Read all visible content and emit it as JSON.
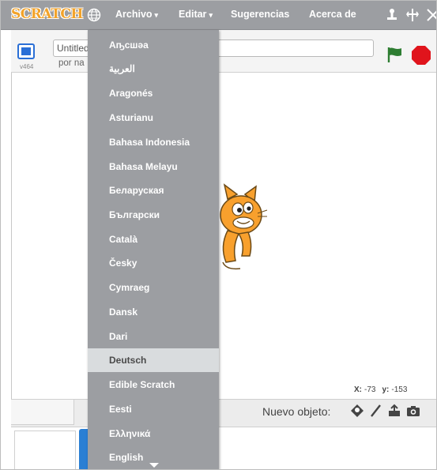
{
  "menubar": {
    "logo_text": "SCRATCH",
    "globe_icon": "globe-icon",
    "menus": [
      {
        "label": "Archivo",
        "has_arrow": true
      },
      {
        "label": "Editar",
        "has_arrow": true
      },
      {
        "label": "Sugerencias"
      },
      {
        "label": "Acerca de"
      }
    ],
    "arrow_glyph": "▾",
    "tool_icons": [
      "duplicate-stamp-icon",
      "cut-scissors-icon",
      "grow-icon"
    ]
  },
  "stage": {
    "version": "v464",
    "title_value": "Untitled",
    "byline": "por na"
  },
  "coords": {
    "x_label": "X:",
    "x_value": "-73",
    "y_label": "y:",
    "y_value": "-153"
  },
  "sprites": {
    "new_sprite_label": "Nuevo objeto:",
    "new_sprite_icons": [
      "sprite-library-icon",
      "paint-brush-icon",
      "upload-sprite-icon",
      "camera-icon"
    ]
  },
  "language_menu": {
    "items": [
      "Аҧсшәа",
      "العربية",
      "Aragonés",
      "Asturianu",
      "Bahasa Indonesia",
      "Bahasa Melayu",
      "Беларуская",
      "Български",
      "Català",
      "Česky",
      "Cymraeg",
      "Dansk",
      "Dari",
      "Deutsch",
      "Edible Scratch",
      "Eesti",
      "Ελληνικά",
      "English"
    ],
    "highlighted": "Deutsch"
  },
  "colors": {
    "menubar_bg": "#9c9ea2",
    "menu_highlight": "#d9dcde",
    "flag_green": "#2e7d32",
    "stop_red": "#e0141c",
    "accent_blue": "#2a6fd6",
    "cat_orange": "#f8a02d"
  }
}
